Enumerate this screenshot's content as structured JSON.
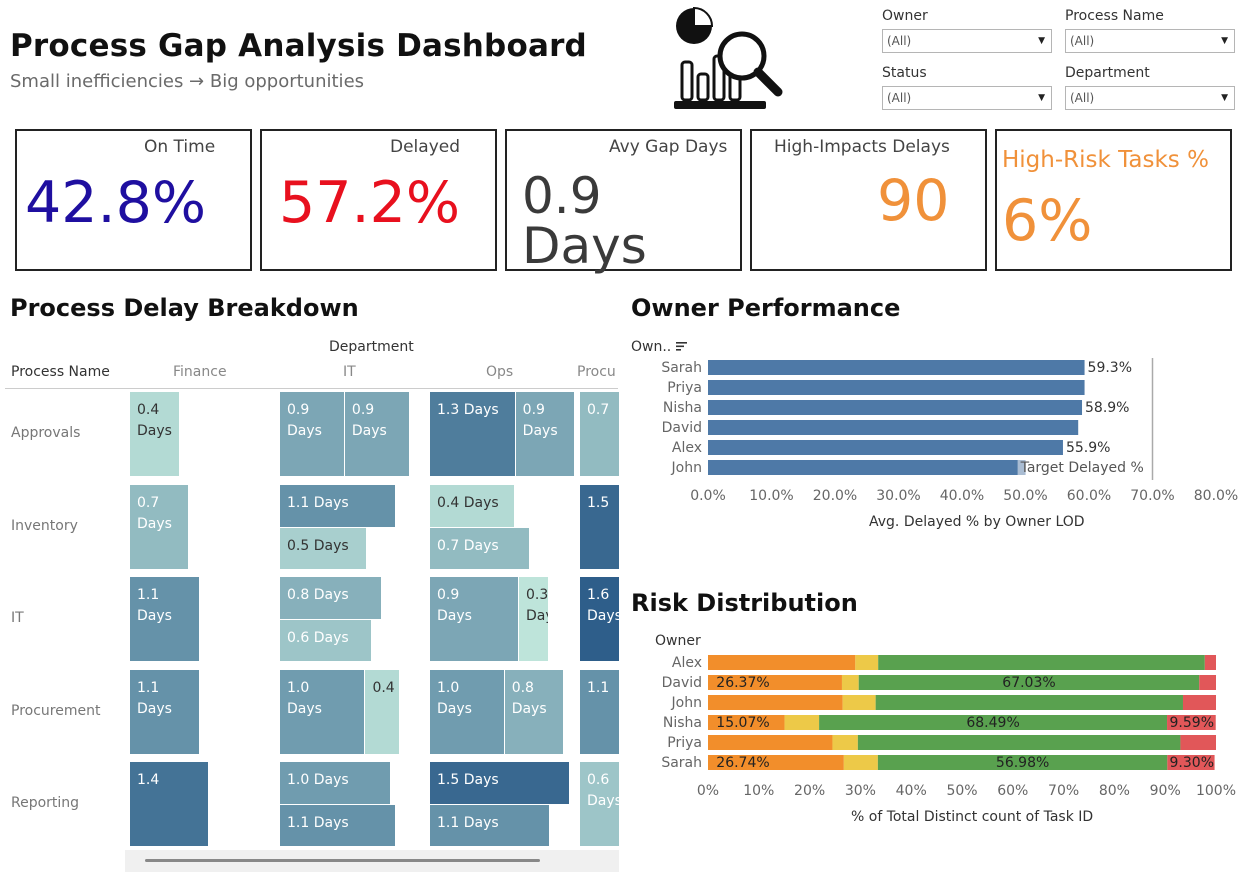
{
  "header": {
    "title": "Process Gap Analysis Dashboard",
    "subtitle": "Small inefficiencies → Big opportunities"
  },
  "logo": {
    "icon": "chart-magnifier-icon"
  },
  "filters": [
    {
      "label": "Owner",
      "value": "(All)"
    },
    {
      "label": "Process Name",
      "value": "(All)"
    },
    {
      "label": "Status",
      "value": "(All)"
    },
    {
      "label": "Department",
      "value": "(All)"
    }
  ],
  "kpis": [
    {
      "label": "On Time",
      "value": "42.8%",
      "color": "#1f0fa0"
    },
    {
      "label": "Delayed",
      "value": "57.2%",
      "color": "#e8101e"
    },
    {
      "label": "Avy Gap Days",
      "value": "0.9 Days",
      "color": "#3a3a3a"
    },
    {
      "label": "High-Impacts Delays",
      "value": "90",
      "color": "#f0913a"
    },
    {
      "label": "High-Risk Tasks %",
      "value": "6%",
      "color": "#f0913a"
    }
  ],
  "breakdown": {
    "title": "Process Delay Breakdown",
    "column_group": "Department",
    "row_header": "Process Name",
    "columns": [
      "Finance",
      "IT",
      "Ops",
      "Procu"
    ],
    "rows": [
      "Approvals",
      "Inventory",
      "IT",
      "Procurement",
      "Reporting"
    ],
    "cells": [
      {
        "row": 0,
        "col": 0,
        "text": "0.4\nDays",
        "value": 0.4
      },
      {
        "row": 0,
        "col": 1,
        "text": "0.9\nDays",
        "value": 0.9
      },
      {
        "row": 0,
        "col": 1,
        "text": "0.9\nDays",
        "value": 0.9
      },
      {
        "row": 0,
        "col": 2,
        "text": "1.3 Days",
        "value": 1.3
      },
      {
        "row": 0,
        "col": 2,
        "text": "0.9\nDays",
        "value": 0.9
      },
      {
        "row": 0,
        "col": 3,
        "text": "0.7",
        "value": 0.7
      },
      {
        "row": 1,
        "col": 0,
        "text": "0.7\nDays",
        "value": 0.7
      },
      {
        "row": 1,
        "col": 1,
        "text": "1.1 Days",
        "value": 1.1
      },
      {
        "row": 1,
        "col": 1,
        "text": "0.5 Days",
        "value": 0.5
      },
      {
        "row": 1,
        "col": 2,
        "text": "0.4 Days",
        "value": 0.4
      },
      {
        "row": 1,
        "col": 2,
        "text": "0.7 Days",
        "value": 0.7
      },
      {
        "row": 1,
        "col": 3,
        "text": "1.5",
        "value": 1.5
      },
      {
        "row": 2,
        "col": 0,
        "text": "1.1\nDays",
        "value": 1.1
      },
      {
        "row": 2,
        "col": 1,
        "text": "0.8 Days",
        "value": 0.8
      },
      {
        "row": 2,
        "col": 1,
        "text": "0.6 Days",
        "value": 0.6
      },
      {
        "row": 2,
        "col": 2,
        "text": "0.9\nDays",
        "value": 0.9
      },
      {
        "row": 2,
        "col": 2,
        "text": "0.3\nDays",
        "value": 0.3
      },
      {
        "row": 2,
        "col": 3,
        "text": "1.6\nDays",
        "value": 1.6
      },
      {
        "row": 3,
        "col": 0,
        "text": "1.1\nDays",
        "value": 1.1
      },
      {
        "row": 3,
        "col": 1,
        "text": "1.0\nDays",
        "value": 1.0
      },
      {
        "row": 3,
        "col": 1,
        "text": "0.4",
        "value": 0.4
      },
      {
        "row": 3,
        "col": 2,
        "text": "1.0\nDays",
        "value": 1.0
      },
      {
        "row": 3,
        "col": 2,
        "text": "0.8\nDays",
        "value": 0.8
      },
      {
        "row": 3,
        "col": 3,
        "text": "1.1",
        "value": 1.1
      },
      {
        "row": 4,
        "col": 0,
        "text": "1.4",
        "value": 1.4
      },
      {
        "row": 4,
        "col": 1,
        "text": "1.0 Days",
        "value": 1.0
      },
      {
        "row": 4,
        "col": 1,
        "text": "1.1 Days",
        "value": 1.1
      },
      {
        "row": 4,
        "col": 2,
        "text": "1.5 Days",
        "value": 1.5
      },
      {
        "row": 4,
        "col": 2,
        "text": "1.1 Days",
        "value": 1.1
      },
      {
        "row": 4,
        "col": 3,
        "text": "0.6\nDays",
        "value": 0.6
      }
    ]
  },
  "owner_performance": {
    "title": "Owner Performance",
    "row_header": "Own..",
    "sort_icon": "sort-descending-icon",
    "axis_title": "Avg. Delayed % by Owner LOD",
    "reference_label": "Target Delayed %"
  },
  "risk_distribution": {
    "title": "Risk Distribution",
    "row_header": "Owner",
    "axis_title": "% of Total Distinct count of Task ID"
  },
  "colors": {
    "bar": "#4e79a7",
    "risk_orange": "#f28e2b",
    "risk_yellow": "#edc948",
    "risk_green": "#59a14f",
    "risk_red": "#e15759"
  },
  "chart_data": [
    {
      "type": "bar",
      "orientation": "horizontal",
      "categories": [
        "Sarah",
        "Priya",
        "Nisha",
        "David",
        "Alex",
        "John"
      ],
      "values": [
        59.3,
        59.3,
        58.9,
        58.3,
        55.9,
        49.7
      ],
      "data_labels": [
        "59.3%",
        "",
        "58.9%",
        "",
        "55.9%",
        ""
      ],
      "reference_line": 70.0,
      "reference_label": "Target Delayed %",
      "xlim": [
        0,
        80
      ],
      "xticks": [
        "0.0%",
        "10.0%",
        "20.0%",
        "30.0%",
        "40.0%",
        "50.0%",
        "60.0%",
        "70.0%",
        "80.0%"
      ],
      "xlabel": "Avg. Delayed % by Owner LOD",
      "ylabel": "Own.."
    },
    {
      "type": "bar",
      "stacked": true,
      "orientation": "horizontal",
      "categories": [
        "Alex",
        "David",
        "John",
        "Nisha",
        "Priya",
        "Sarah"
      ],
      "series": [
        {
          "color": "#f28e2b",
          "values": [
            29.0,
            26.37,
            26.5,
            15.07,
            24.5,
            26.74
          ],
          "labels": [
            "",
            "26.37%",
            "",
            "15.07%",
            "",
            "26.74%"
          ]
        },
        {
          "color": "#edc948",
          "values": [
            4.5,
            3.3,
            6.5,
            6.8,
            5.0,
            6.7
          ],
          "labels": [
            "",
            "",
            "",
            "",
            "",
            ""
          ]
        },
        {
          "color": "#59a14f",
          "values": [
            64.3,
            67.03,
            60.5,
            68.49,
            63.5,
            56.98
          ],
          "labels": [
            "",
            "67.03%",
            "",
            "68.49%",
            "",
            "56.98%"
          ]
        },
        {
          "color": "#e15759",
          "values": [
            2.2,
            3.3,
            6.5,
            9.59,
            7.0,
            9.3
          ],
          "labels": [
            "",
            "",
            "",
            "9.59%",
            "",
            "9.30%"
          ]
        }
      ],
      "xlim": [
        0,
        100
      ],
      "xticks": [
        "0%",
        "10%",
        "20%",
        "30%",
        "40%",
        "50%",
        "60%",
        "70%",
        "80%",
        "90%",
        "100%"
      ],
      "xlabel": "% of Total Distinct count of Task ID",
      "ylabel": "Owner"
    }
  ]
}
